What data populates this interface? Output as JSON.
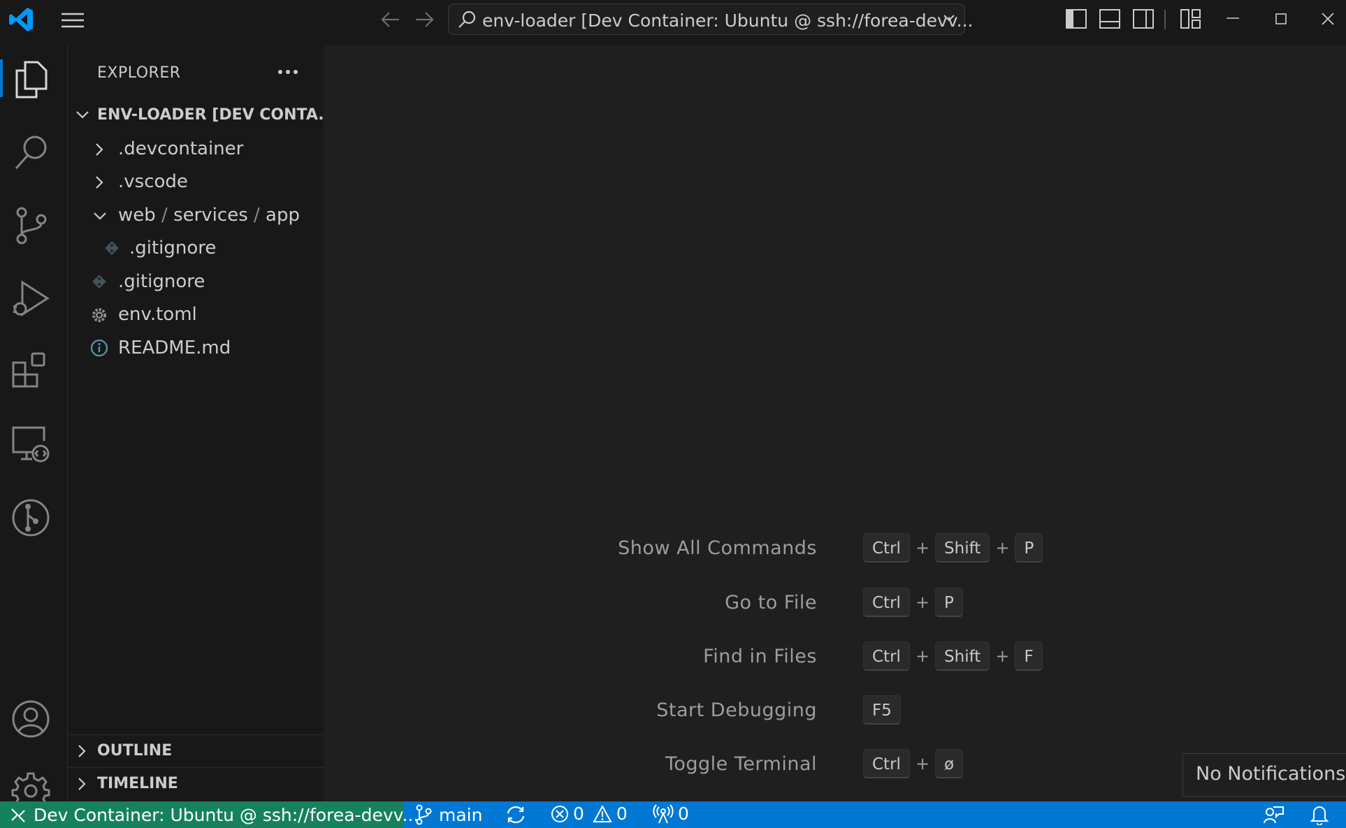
{
  "titlebar": {
    "command_center_text": "env-loader [Dev Container: Ubuntu @ ssh://forea-devv..."
  },
  "sidebar": {
    "title": "EXPLORER",
    "root_label": "ENV-LOADER [DEV CONTA...",
    "items": [
      {
        "label": ".devcontainer",
        "kind": "folder-collapsed"
      },
      {
        "label": ".vscode",
        "kind": "folder-collapsed"
      },
      {
        "label_parts": [
          "web",
          "/",
          "services",
          "/",
          "app"
        ],
        "kind": "folder-expanded"
      },
      {
        "label": ".gitignore",
        "kind": "git-file",
        "nested": true
      },
      {
        "label": ".gitignore",
        "kind": "git-file"
      },
      {
        "label": "env.toml",
        "kind": "settings-file"
      },
      {
        "label": "README.md",
        "kind": "info-file"
      }
    ],
    "outline_label": "OUTLINE",
    "timeline_label": "TIMELINE"
  },
  "editor": {
    "shortcuts": [
      {
        "label": "Show All Commands",
        "keys": [
          "Ctrl",
          "+",
          "Shift",
          "+",
          "P"
        ]
      },
      {
        "label": "Go to File",
        "keys": [
          "Ctrl",
          "+",
          "P"
        ]
      },
      {
        "label": "Find in Files",
        "keys": [
          "Ctrl",
          "+",
          "Shift",
          "+",
          "F"
        ]
      },
      {
        "label": "Start Debugging",
        "keys": [
          "F5"
        ]
      },
      {
        "label": "Toggle Terminal",
        "keys": [
          "Ctrl",
          "+",
          "ø"
        ]
      }
    ]
  },
  "notification": {
    "text": "No Notifications"
  },
  "statusbar": {
    "remote_label": "Dev Container: Ubuntu @ ssh://forea-devv...",
    "branch": "main",
    "errors": "0",
    "warnings": "0",
    "ports": "0"
  },
  "colors": {
    "status_blue": "#0078d4",
    "remote_green": "#16825d",
    "vscode_logo": "#0098ff"
  }
}
